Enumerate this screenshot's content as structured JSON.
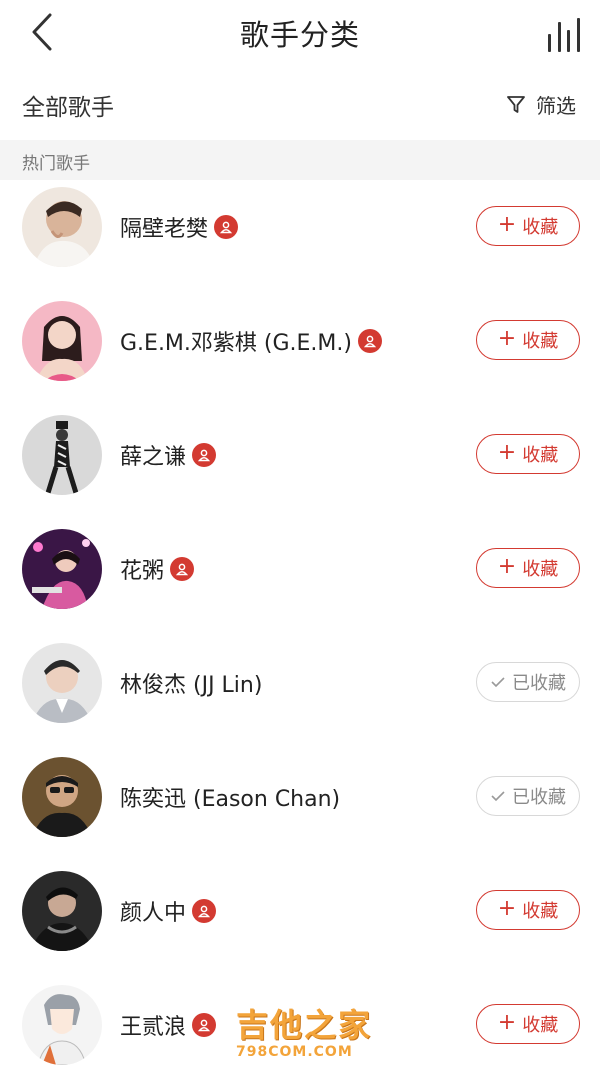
{
  "navbar": {
    "title": "歌手分类"
  },
  "filter_row": {
    "all_label": "全部歌手",
    "filter_label": "筛选"
  },
  "section": {
    "title": "热门歌手"
  },
  "singers": [
    {
      "name": "隔壁老樊",
      "verified": true,
      "button": "收藏",
      "followed": false,
      "avatar_colors": [
        "#efe7df",
        "#7a5a46"
      ]
    },
    {
      "name": "G.E.M.邓紫棋 (G.E.M.)",
      "verified": true,
      "button": "收藏",
      "followed": false,
      "avatar_colors": [
        "#f5b8c5",
        "#2c1c1c"
      ]
    },
    {
      "name": "薛之谦",
      "verified": true,
      "button": "收藏",
      "followed": false,
      "avatar_colors": [
        "#d9d9d9",
        "#1c1c1c"
      ]
    },
    {
      "name": "花粥",
      "verified": true,
      "button": "收藏",
      "followed": false,
      "avatar_colors": [
        "#3a1646",
        "#d85aa0"
      ]
    },
    {
      "name": "林俊杰 (JJ Lin)",
      "verified": false,
      "button": "已收藏",
      "followed": true,
      "avatar_colors": [
        "#e6e6e6",
        "#3a3a3a"
      ]
    },
    {
      "name": "陈奕迅 (Eason Chan)",
      "verified": false,
      "button": "已收藏",
      "followed": true,
      "avatar_colors": [
        "#6b5230",
        "#1a1a1a"
      ]
    },
    {
      "name": "颜人中",
      "verified": true,
      "button": "收藏",
      "followed": false,
      "avatar_colors": [
        "#2a2a2a",
        "#8a8a8a"
      ]
    },
    {
      "name": "王贰浪",
      "verified": true,
      "button": "收藏",
      "followed": false,
      "avatar_colors": [
        "#f4f4f4",
        "#9aa0a8"
      ]
    }
  ],
  "watermark": {
    "main": "吉他之家",
    "sub": "798COM.COM"
  },
  "colors": {
    "accent": "#d33a31",
    "followed_border": "#d8d8d8",
    "followed_text": "#8a8a8a",
    "section_bg": "#f4f4f4",
    "watermark": "#f3a43a"
  },
  "icons": {
    "back": "chevron-left-icon",
    "playing": "equalizer-bars-icon",
    "filter": "funnel-icon",
    "verified": "person-badge-icon",
    "add": "plus-icon",
    "followed": "check-icon"
  }
}
